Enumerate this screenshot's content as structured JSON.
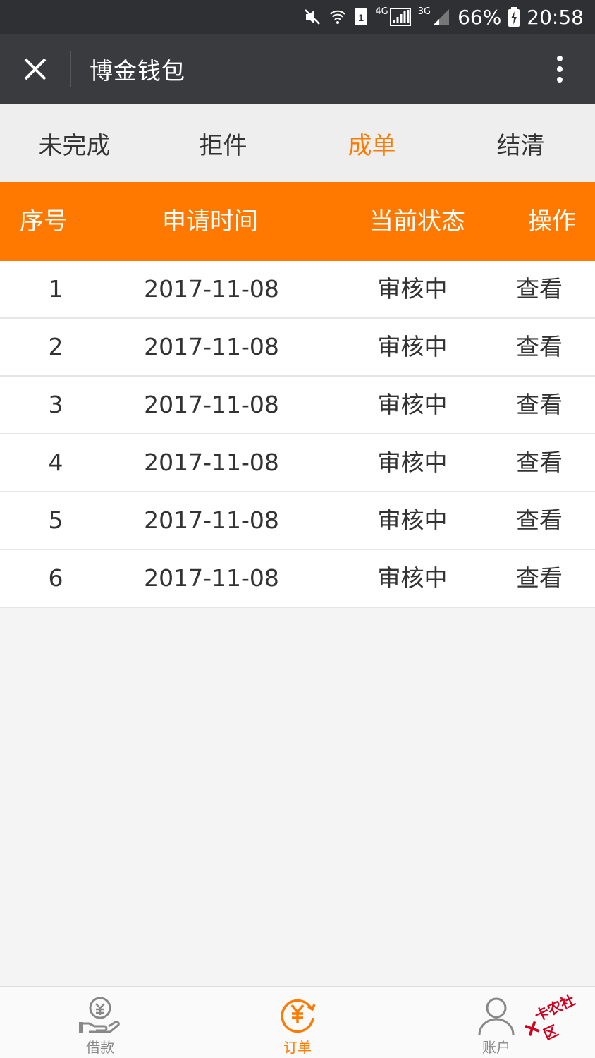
{
  "status_bar": {
    "network_4g": "4G",
    "network_3g": "3G",
    "battery": "66%",
    "time": "20:58"
  },
  "header": {
    "title": "博金钱包"
  },
  "tabs": [
    {
      "label": "未完成"
    },
    {
      "label": "拒件"
    },
    {
      "label": "成单"
    },
    {
      "label": "结清"
    }
  ],
  "active_tab": "成单",
  "table": {
    "columns": [
      "序号",
      "申请时间",
      "当前状态",
      "操作"
    ],
    "rows": [
      {
        "no": "1",
        "date": "2017-11-08",
        "status": "审核中",
        "action": "查看"
      },
      {
        "no": "2",
        "date": "2017-11-08",
        "status": "审核中",
        "action": "查看"
      },
      {
        "no": "3",
        "date": "2017-11-08",
        "status": "审核中",
        "action": "查看"
      },
      {
        "no": "4",
        "date": "2017-11-08",
        "status": "审核中",
        "action": "查看"
      },
      {
        "no": "5",
        "date": "2017-11-08",
        "status": "审核中",
        "action": "查看"
      },
      {
        "no": "6",
        "date": "2017-11-08",
        "status": "审核中",
        "action": "查看"
      }
    ]
  },
  "bottom_nav": [
    {
      "label": "借款",
      "icon": "loan-hand-icon"
    },
    {
      "label": "订单",
      "icon": "order-yen-icon"
    },
    {
      "label": "账户",
      "icon": "account-person-icon"
    }
  ],
  "watermark": {
    "text": "卡农社区"
  },
  "colors": {
    "accent": "#ff7800",
    "header_bg": "#3a3b3f",
    "status_bg": "#2f3033"
  }
}
